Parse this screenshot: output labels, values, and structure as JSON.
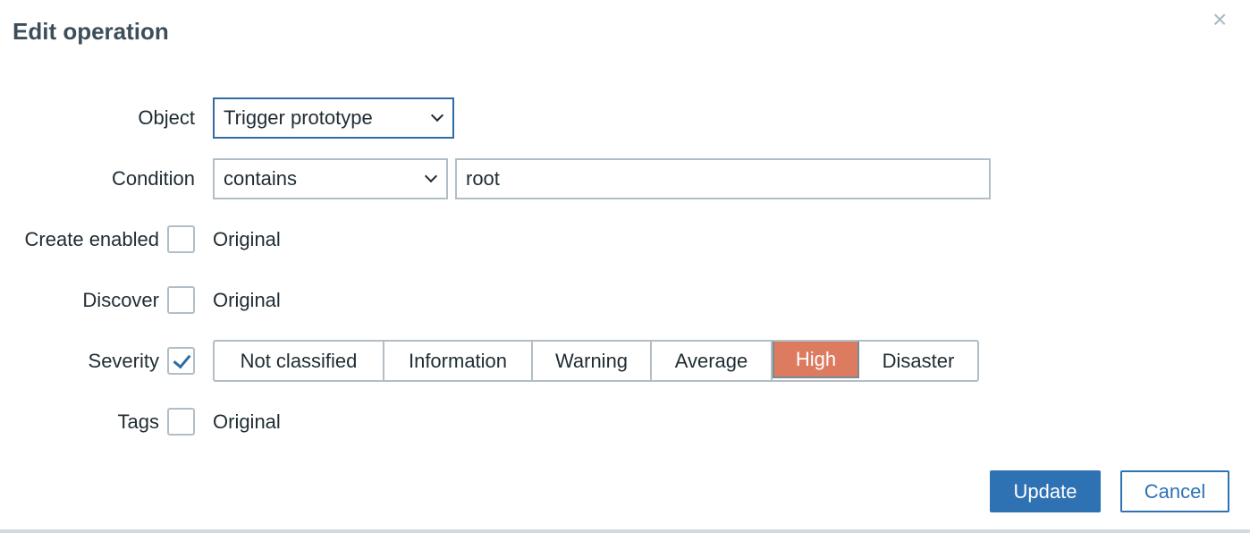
{
  "dialog": {
    "title": "Edit operation",
    "close_icon": "×"
  },
  "form": {
    "object_label": "Object",
    "object_value": "Trigger prototype",
    "condition_label": "Condition",
    "condition_value": "contains",
    "condition_text": "root",
    "create_enabled_label": "Create enabled",
    "create_enabled_checked": false,
    "create_enabled_value": "Original",
    "discover_label": "Discover",
    "discover_checked": false,
    "discover_value": "Original",
    "severity_label": "Severity",
    "severity_checked": true,
    "severity_options": [
      "Not classified",
      "Information",
      "Warning",
      "Average",
      "High",
      "Disaster"
    ],
    "severity_selected": "High",
    "tags_label": "Tags",
    "tags_checked": false,
    "tags_value": "Original"
  },
  "buttons": {
    "update": "Update",
    "cancel": "Cancel"
  },
  "colors": {
    "accent": "#2f72b3",
    "high": "#dc7b60"
  }
}
